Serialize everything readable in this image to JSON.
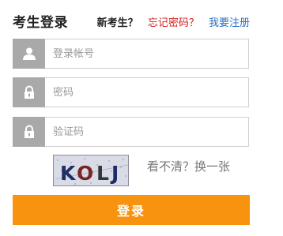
{
  "header": {
    "title": "考生登录",
    "new_examinee": "新考生？",
    "forgot_password": "忘记密码？",
    "register": "我要注册"
  },
  "form": {
    "username": {
      "placeholder": "登录帐号",
      "value": "",
      "icon": "user-icon"
    },
    "password": {
      "placeholder": "密码",
      "value": "",
      "icon": "lock-icon"
    },
    "captcha": {
      "placeholder": "验证码",
      "value": "",
      "icon": "lock-icon"
    }
  },
  "captcha_image": {
    "text": "KOLJ",
    "chars": [
      "K",
      "O",
      "L",
      "J"
    ]
  },
  "captcha_refresh": "看不清？换一张",
  "login_button": "登录",
  "colors": {
    "accent": "#f7930f",
    "icon_bg": "#a9a9a9",
    "forgot_link": "#d42020",
    "register_link": "#2a6fc4"
  }
}
